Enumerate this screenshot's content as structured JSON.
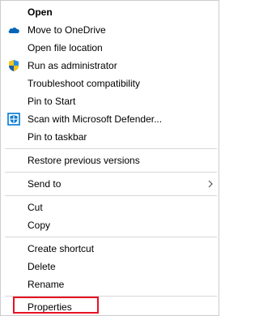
{
  "menu": {
    "open": "Open",
    "move_to_onedrive": {
      "label": "Move to OneDrive",
      "icon": "onedrive-cloud-icon"
    },
    "open_file_location": "Open file location",
    "run_as_admin": {
      "label": "Run as administrator",
      "icon": "uac-shield-icon"
    },
    "troubleshoot": "Troubleshoot compatibility",
    "pin_to_start": "Pin to Start",
    "scan_defender": {
      "label": "Scan with Microsoft Defender...",
      "icon": "defender-icon"
    },
    "pin_to_taskbar": "Pin to taskbar",
    "restore_versions": "Restore previous versions",
    "send_to": {
      "label": "Send to",
      "icon": "chevron-right-icon"
    },
    "cut": "Cut",
    "copy": "Copy",
    "create_shortcut": "Create shortcut",
    "delete": "Delete",
    "rename": "Rename",
    "properties": "Properties"
  },
  "colors": {
    "highlight_border": "#e81123",
    "onedrive_blue": "#0364b8",
    "defender_blue": "#0078d4",
    "separator": "#d7d7d7"
  }
}
